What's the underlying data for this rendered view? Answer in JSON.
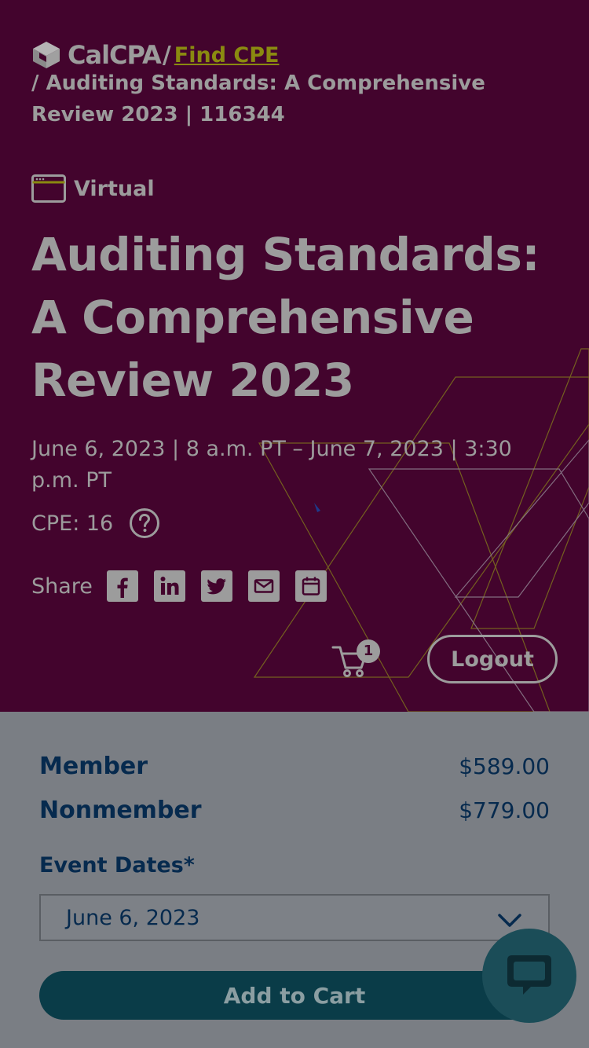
{
  "breadcrumb": {
    "logo_text": "CalCPA",
    "separator": "/",
    "link_label": "Find CPE",
    "rest": "/ Auditing Standards: A Comprehensive Review 2023 | 116344"
  },
  "event": {
    "type_label": "Virtual",
    "title": "Auditing Standards: A Comprehensive Review 2023",
    "date_text": "June 6, 2023 | 8 a.m. PT – June 7, 2023 | 3:30 p.m. PT",
    "cpe_label": "CPE: 16"
  },
  "share": {
    "label": "Share",
    "icons": [
      "facebook-icon",
      "linkedin-icon",
      "twitter-icon",
      "email-icon",
      "calendar-icon"
    ]
  },
  "header_actions": {
    "cart_count": "1",
    "logout_label": "Logout"
  },
  "pricing": {
    "member_label": "Member",
    "member_price": "$589.00",
    "nonmember_label": "Nonmember",
    "nonmember_price": "$779.00"
  },
  "registration": {
    "dates_label": "Event Dates*",
    "selected_date": "June 6, 2023",
    "add_to_cart_label": "Add to Cart"
  },
  "colors": {
    "hero_bg": "#43042d",
    "panel_bg": "#7a7e84",
    "navy": "#062a4e",
    "teal": "#0a3c48",
    "link": "#8a8a10"
  }
}
